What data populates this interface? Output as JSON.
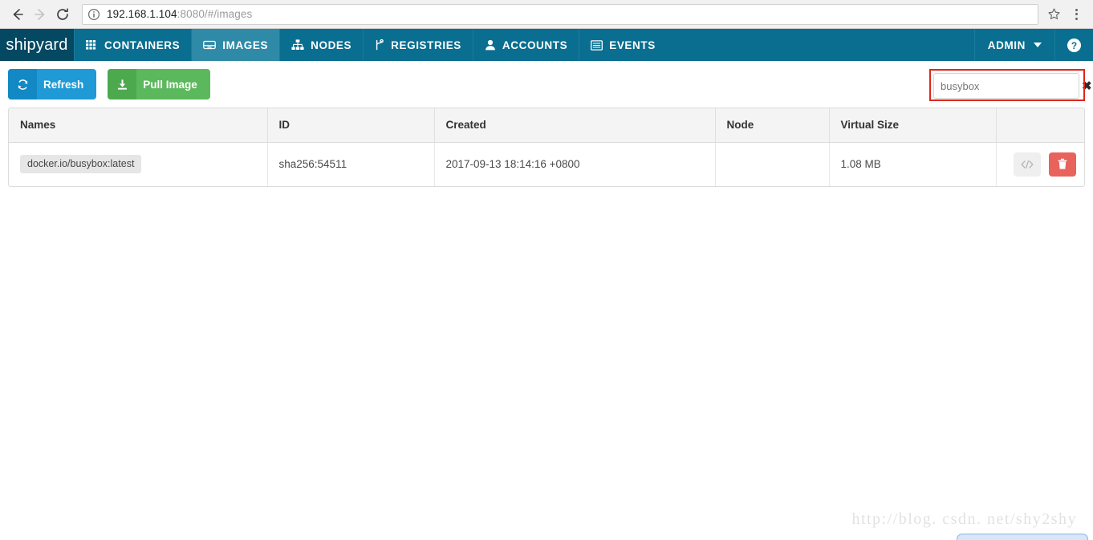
{
  "browser": {
    "back_icon": "back-arrow-icon",
    "forward_icon": "forward-arrow-icon",
    "reload_icon": "reload-icon",
    "info_icon": "site-info-icon",
    "url_host": "192.168.1.104",
    "url_rest": ":8080/#/images",
    "url_full": "192.168.1.104:8080/#/images",
    "star_icon": "bookmark-star-icon",
    "menu_icon": "three-dot-menu-icon"
  },
  "navbar": {
    "brand": "shipyard",
    "items": [
      {
        "label": "CONTAINERS",
        "icon": "grid-icon",
        "active": false
      },
      {
        "label": "IMAGES",
        "icon": "image-disk-icon",
        "active": true
      },
      {
        "label": "NODES",
        "icon": "sitemap-icon",
        "active": false
      },
      {
        "label": "REGISTRIES",
        "icon": "code-branch-icon",
        "active": false
      },
      {
        "label": "ACCOUNTS",
        "icon": "user-icon",
        "active": false
      },
      {
        "label": "EVENTS",
        "icon": "list-lines-icon",
        "active": false
      }
    ],
    "admin_label": "ADMIN",
    "admin_caret_icon": "chevron-down-icon",
    "help_icon": "help-circle-icon"
  },
  "toolbar": {
    "refresh_label": "Refresh",
    "refresh_icon": "refresh-icon",
    "pull_image_label": "Pull Image",
    "pull_image_icon": "download-icon"
  },
  "search": {
    "value": "busybox",
    "placeholder": "",
    "clear_icon": "clear-x-icon",
    "highlight_color": "#e1251b"
  },
  "table": {
    "columns": [
      "Names",
      "ID",
      "Created",
      "Node",
      "Virtual Size",
      ""
    ],
    "rows": [
      {
        "name": "docker.io/busybox:latest",
        "id": "sha256:54511",
        "created": "2017-09-13 18:14:16 +0800",
        "node": "",
        "virtual_size": "1.08 MB",
        "inspect_icon": "code-brackets-icon",
        "delete_icon": "trash-icon"
      }
    ]
  },
  "watermark": {
    "text": "http://blog. csdn. net/shy2shy"
  },
  "colors": {
    "navbar": "#0a6e90",
    "brand_bg": "#054862",
    "active_tab": "#2f8aa8",
    "refresh_blue": "#1f9ad6",
    "pull_green": "#5cb85c",
    "delete_red": "#e8635c",
    "annotation_red": "#e1251b"
  }
}
